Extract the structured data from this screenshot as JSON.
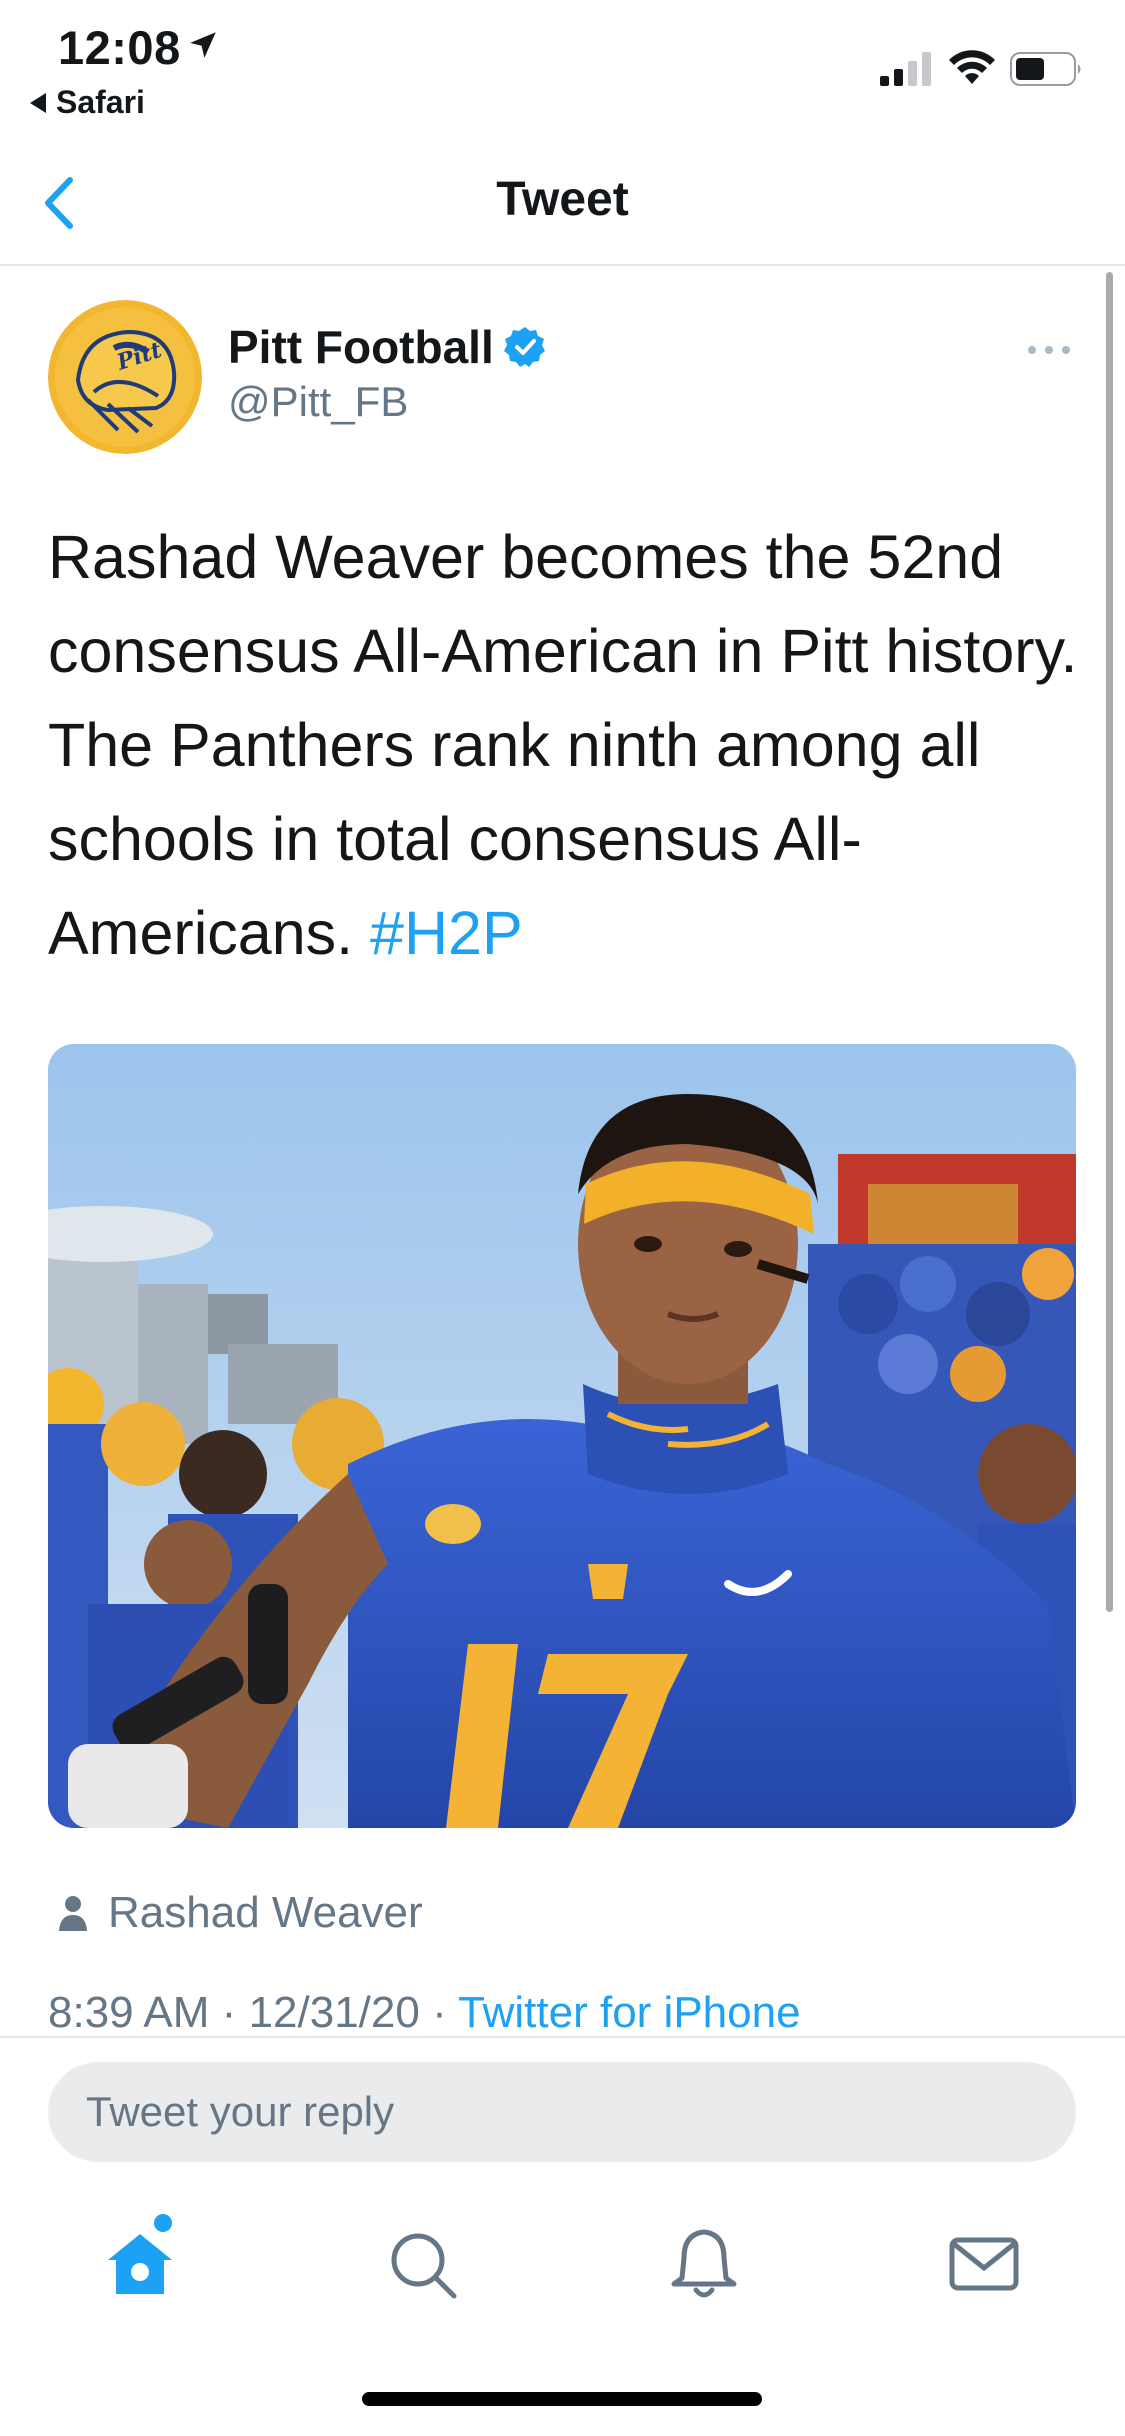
{
  "status_bar": {
    "time": "12:08",
    "back_app": "Safari",
    "icons": [
      "location-arrow-icon",
      "signal-icon",
      "wifi-icon",
      "battery-icon"
    ]
  },
  "nav": {
    "title": "Tweet",
    "back_icon": "chevron-left-icon"
  },
  "tweet": {
    "author_name": "Pitt Football",
    "author_handle": "@Pitt_FB",
    "verified": true,
    "text": "Rashad Weaver becomes the 52nd consensus All-American in Pitt history. The Panthers rank ninth among all schools in total consensus All-Americans. ",
    "hashtag": "#H2P",
    "tagged_person": "Rashad Weaver",
    "time": "8:39 AM",
    "date": "12/31/20",
    "separator": "·",
    "source": "Twitter for iPhone"
  },
  "reply": {
    "placeholder": "Tweet your reply"
  },
  "tab_bar": {
    "tabs": [
      "home-icon",
      "search-icon",
      "notifications-icon",
      "messages-icon"
    ],
    "active": "home-icon"
  },
  "colors": {
    "accent": "#1da1f2",
    "text": "#14171a",
    "secondary": "#657786",
    "divider": "#e1e8ed",
    "pitt_blue": "#2a55c4",
    "pitt_gold": "#f5b335"
  }
}
